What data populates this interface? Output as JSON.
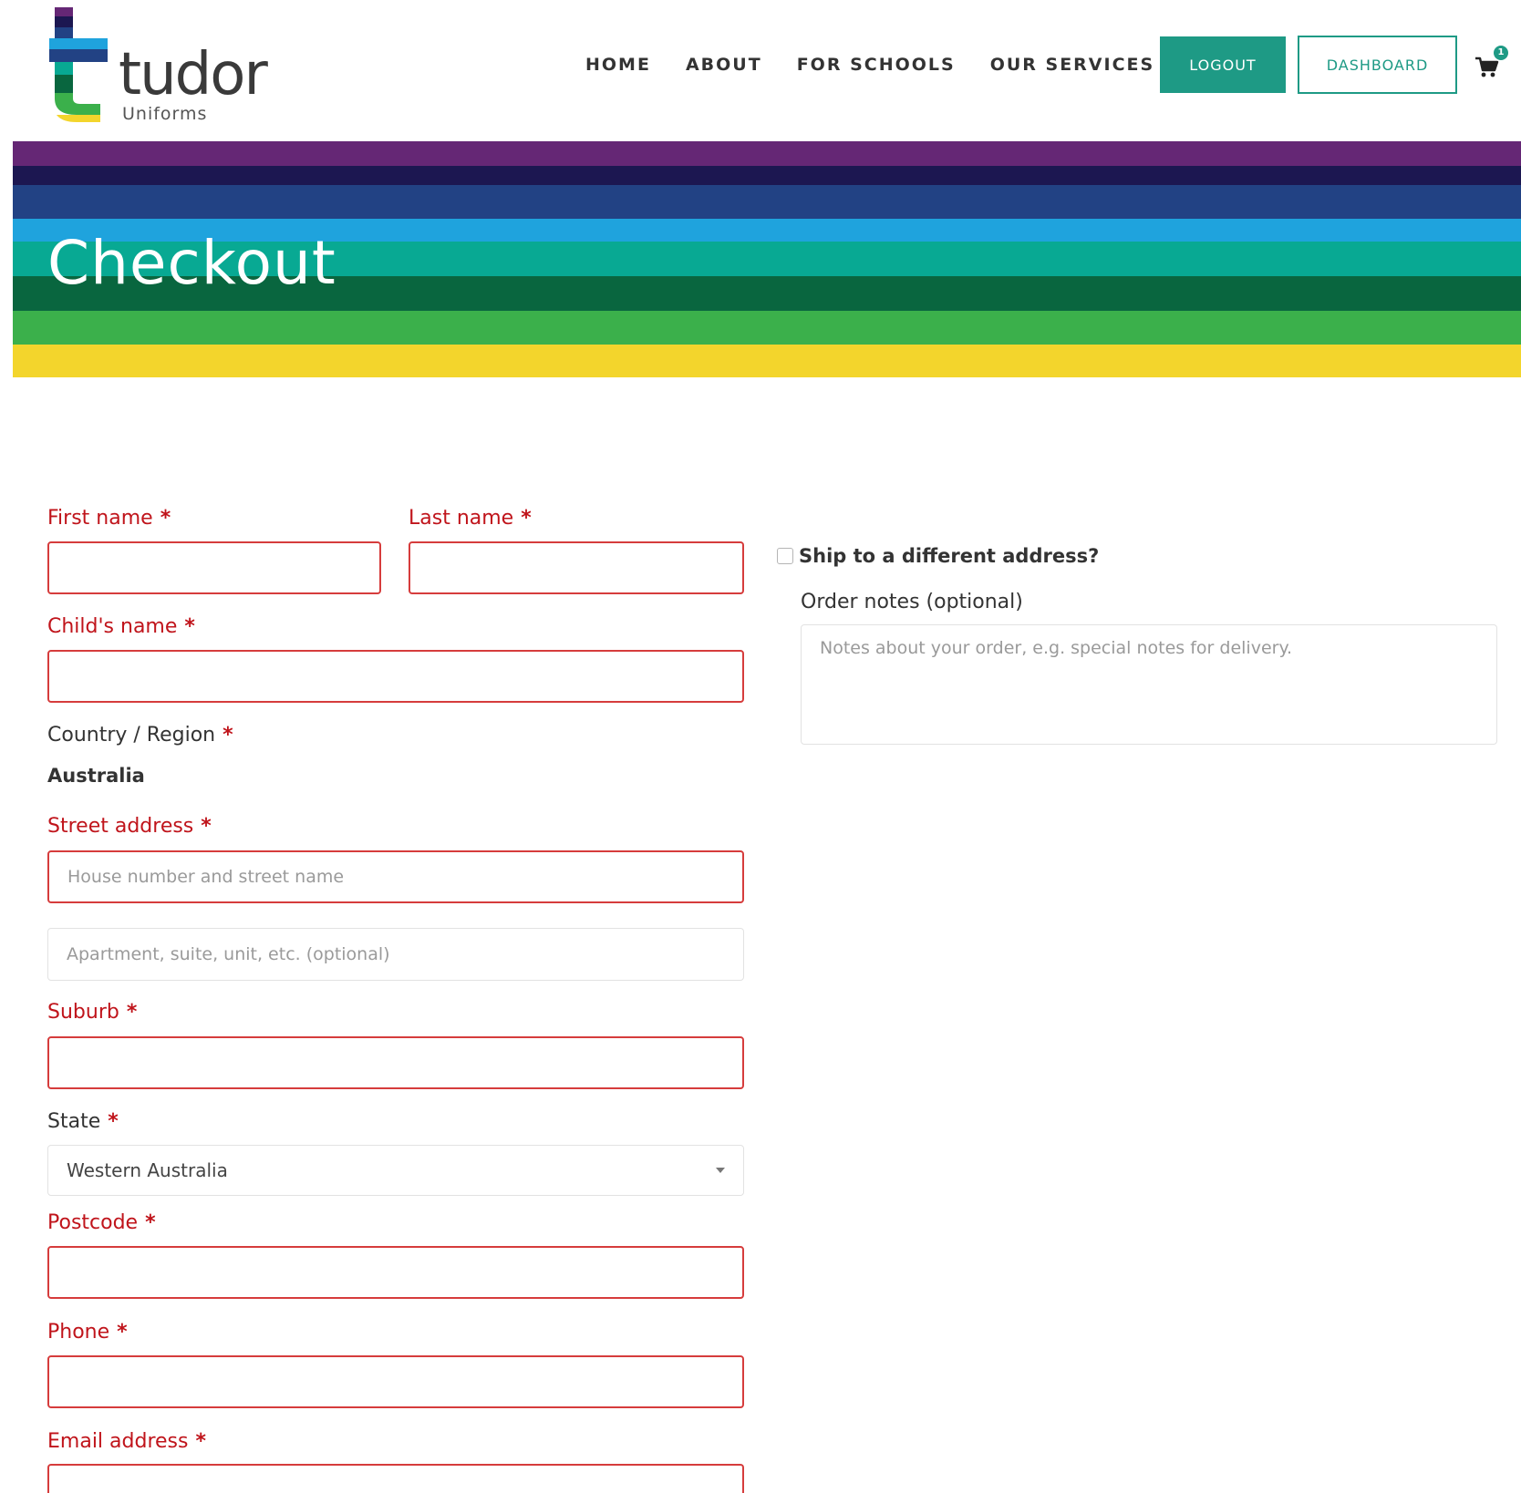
{
  "brand": {
    "name": "tudor",
    "subtitle": "Uniforms"
  },
  "nav": {
    "items": [
      "HOME",
      "ABOUT",
      "FOR SCHOOLS",
      "OUR SERVICES"
    ],
    "logout_label": "LOGOUT",
    "dashboard_label": "DASHBOARD",
    "cart_count": "1"
  },
  "banner": {
    "title": "Checkout",
    "stripe_colors": [
      "#652775",
      "#1c1751",
      "#224284",
      "#1fa3dd",
      "#08a993",
      "#09663f",
      "#3bb04b",
      "#f3d52c"
    ]
  },
  "billing": {
    "first_name_label": "First name",
    "last_name_label": "Last name",
    "child_name_label": "Child's name",
    "country_label": "Country / Region",
    "country_value": "Australia",
    "street_label": "Street address",
    "street_placeholder": "House number and street name",
    "street2_placeholder": "Apartment, suite, unit, etc. (optional)",
    "suburb_label": "Suburb",
    "state_label": "State",
    "state_value": "Western Australia",
    "postcode_label": "Postcode",
    "phone_label": "Phone",
    "email_label": "Email address",
    "required_marker": "*"
  },
  "shipping": {
    "ship_different_label": "Ship to a different address?",
    "order_notes_label": "Order notes (optional)",
    "order_notes_placeholder": "Notes about your order, e.g. special notes for delivery."
  },
  "colors": {
    "accent": "#1e9a85",
    "error": "#c0141b"
  }
}
